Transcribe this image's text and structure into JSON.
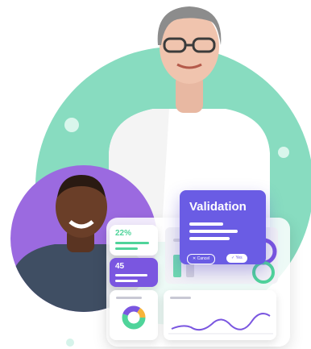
{
  "colors": {
    "mint": "#88dcc0",
    "purple": "#7a56e0",
    "modal": "#6a5ce4",
    "green": "#4fd49a"
  },
  "stats": [
    {
      "value": "22%"
    },
    {
      "value": "45"
    }
  ],
  "modal": {
    "title": "Validation",
    "cancel_label": "Cancel",
    "yes_label": "Yes"
  },
  "icons": [
    "cancel-x-icon",
    "check-icon",
    "donut-chart-icon",
    "line-chart-icon"
  ]
}
